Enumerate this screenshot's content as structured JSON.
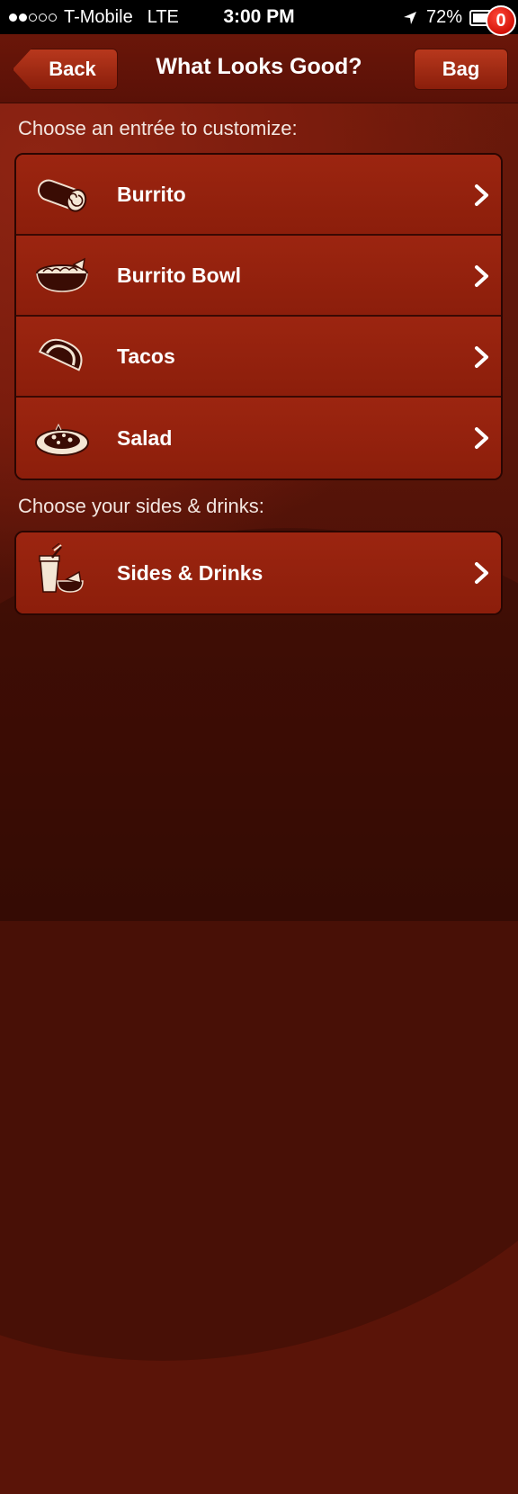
{
  "status_bar": {
    "carrier": "T-Mobile",
    "network": "LTE",
    "time": "3:00 PM",
    "battery": "72%",
    "battery_level": 0.72,
    "signal_bars": 2
  },
  "nav": {
    "back_label": "Back",
    "title": "What Looks Good?",
    "bag_label": "Bag",
    "bag_count": "0"
  },
  "entrees": {
    "heading": "Choose an entrée to customize:",
    "items": [
      {
        "label": "Burrito",
        "icon": "burrito-icon"
      },
      {
        "label": "Burrito Bowl",
        "icon": "burrito-bowl-icon"
      },
      {
        "label": "Tacos",
        "icon": "taco-icon"
      },
      {
        "label": "Salad",
        "icon": "salad-icon"
      }
    ]
  },
  "sides": {
    "heading": "Choose your sides & drinks:",
    "items": [
      {
        "label": "Sides & Drinks",
        "icon": "drink-and-chips-icon"
      }
    ]
  },
  "colors": {
    "background": "#5a1408",
    "row": "#9c2510",
    "badge": "#d31208",
    "text": "#ffffff"
  }
}
